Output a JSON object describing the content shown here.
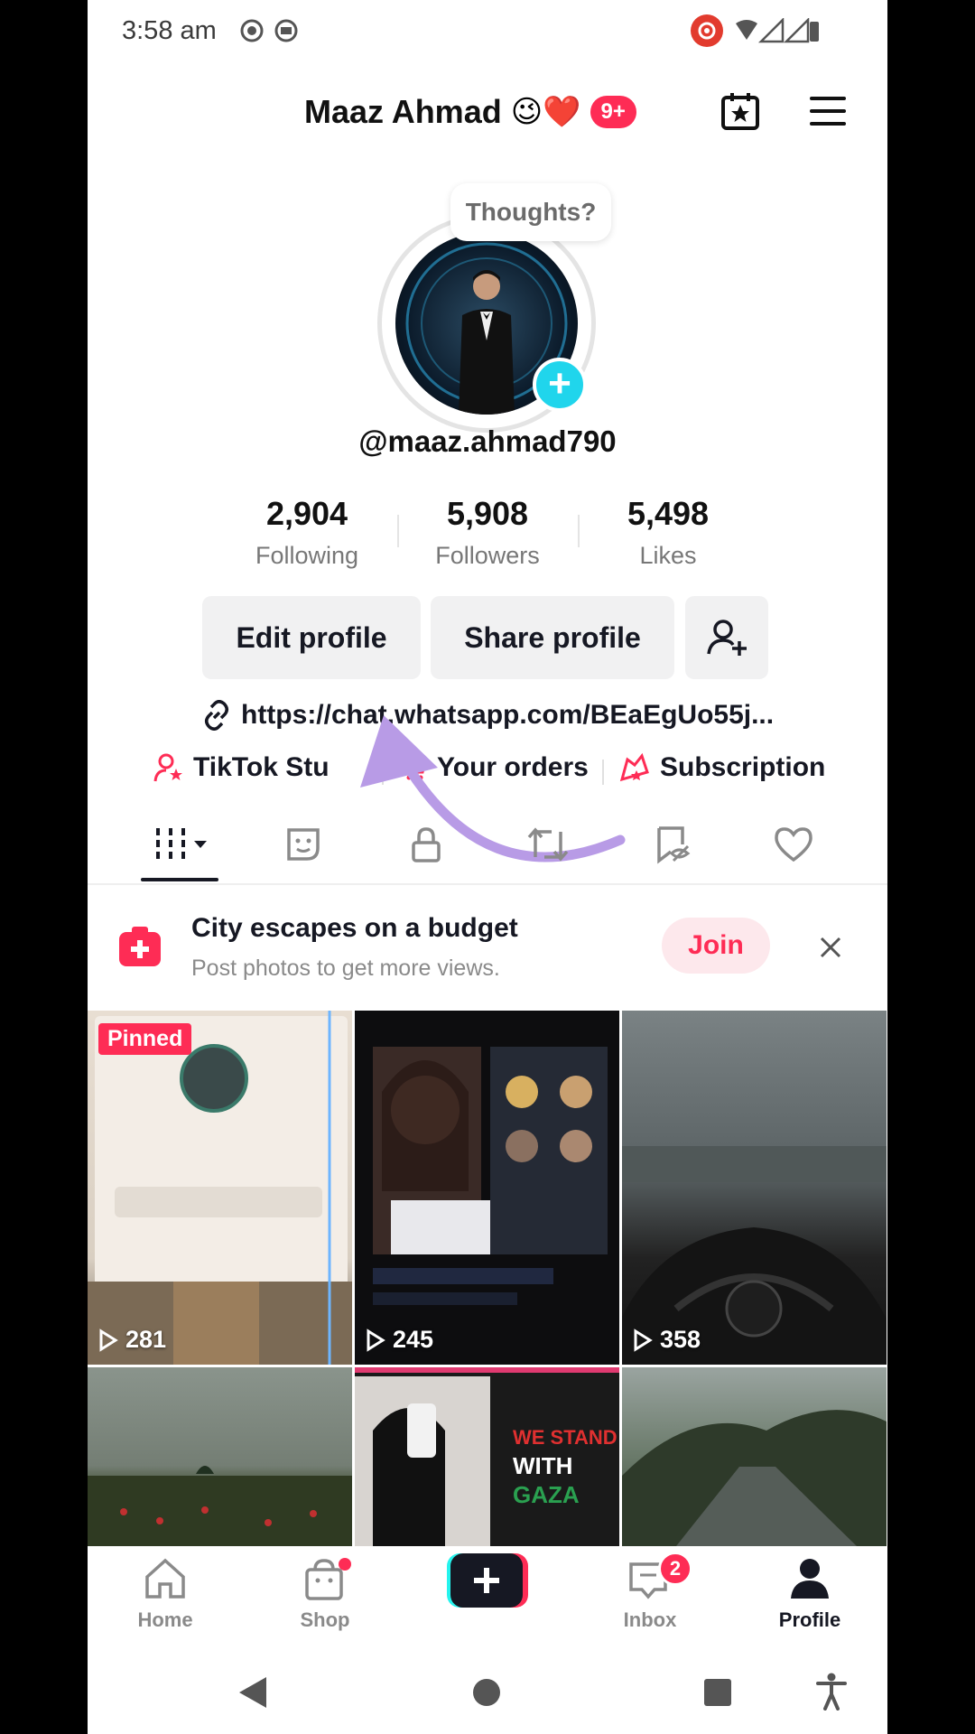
{
  "status_bar": {
    "time": "3:58 am"
  },
  "header": {
    "name": "Maaz Ahmad",
    "emoji": "😉❤️",
    "badge": "9+"
  },
  "avatar": {
    "thought_prompt": "Thoughts?",
    "plus": "+"
  },
  "username": "@maaz.ahmad790",
  "stats": [
    {
      "value": "2,904",
      "label": "Following"
    },
    {
      "value": "5,908",
      "label": "Followers"
    },
    {
      "value": "5,498",
      "label": "Likes"
    }
  ],
  "buttons": {
    "edit": "Edit profile",
    "share": "Share profile"
  },
  "bio_link": "https://chat.whatsapp.com/BEaEgUo55j...",
  "shortcuts": [
    {
      "label": "TikTok Stu",
      "icon": "creator-icon"
    },
    {
      "label": "Your orders",
      "icon": "cart-icon"
    },
    {
      "label": "Subscription",
      "icon": "subscription-icon"
    }
  ],
  "tabs": [
    "videos",
    "stickers",
    "private",
    "reposts",
    "favorites",
    "liked"
  ],
  "promo": {
    "title": "City escapes on a budget",
    "subtitle": "Post photos to get more views.",
    "join": "Join"
  },
  "grid": {
    "pinned_label": "Pinned",
    "counts": [
      "281",
      "245",
      "358"
    ]
  },
  "nav": {
    "home": "Home",
    "shop": "Shop",
    "inbox": "Inbox",
    "inbox_badge": "2",
    "profile": "Profile"
  },
  "colors": {
    "accent": "#fe2c55",
    "cyan": "#20d5ec",
    "arrow": "#b89be6"
  }
}
